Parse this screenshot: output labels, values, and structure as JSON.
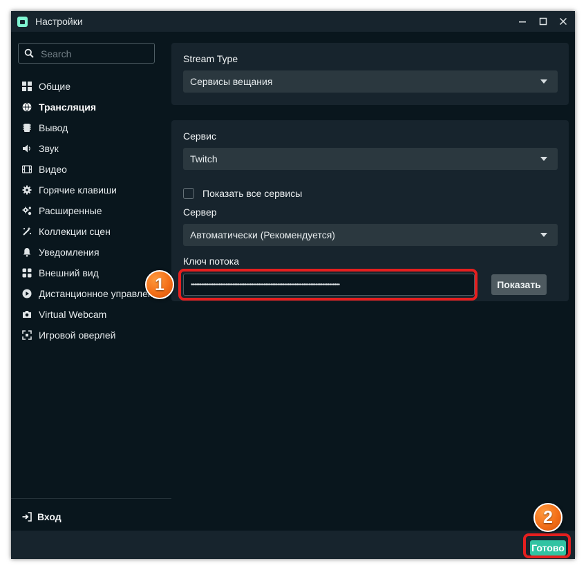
{
  "window": {
    "title": "Настройки"
  },
  "sidebar": {
    "search_placeholder": "Search",
    "items": [
      {
        "label": "Общие",
        "icon": "grid-icon",
        "active": false
      },
      {
        "label": "Трансляция",
        "icon": "globe-icon",
        "active": true
      },
      {
        "label": "Вывод",
        "icon": "chip-icon",
        "active": false
      },
      {
        "label": "Звук",
        "icon": "speaker-icon",
        "active": false
      },
      {
        "label": "Видео",
        "icon": "film-icon",
        "active": false
      },
      {
        "label": "Горячие клавиши",
        "icon": "gear-icon",
        "active": false
      },
      {
        "label": "Расширенные",
        "icon": "gears-icon",
        "active": false
      },
      {
        "label": "Коллекции сцен",
        "icon": "magic-wand-icon",
        "active": false
      },
      {
        "label": "Уведомления",
        "icon": "bell-icon",
        "active": false
      },
      {
        "label": "Внешний вид",
        "icon": "palette-icon",
        "active": false
      },
      {
        "label": "Дистанционное управление",
        "icon": "play-circle-icon",
        "active": false
      },
      {
        "label": "Virtual Webcam",
        "icon": "camera-icon",
        "active": false
      },
      {
        "label": "Игровой оверлей",
        "icon": "overlay-icon",
        "active": false
      }
    ],
    "logout_label": "Вход"
  },
  "stream_type": {
    "label": "Stream Type",
    "value": "Сервисы вещания"
  },
  "service": {
    "label": "Сервис",
    "value": "Twitch",
    "show_all_label": "Показать все сервисы",
    "show_all_checked": false
  },
  "server": {
    "label": "Сервер",
    "value": "Автоматически (Рекомендуется)"
  },
  "stream_key": {
    "label": "Ключ потока",
    "masked_value": "••••••••••••••••••••••••••••••••••••••••••••••••••••••••••••••••••••••••••••••••••••••",
    "show_button": "Показать"
  },
  "footer": {
    "done_label": "Готово"
  },
  "annotations": {
    "step1": "1",
    "step2": "2"
  },
  "colors": {
    "accent": "#31c3a2",
    "background": "#09161d",
    "panel": "#17242d",
    "highlight": "#e51f1f",
    "badge": "#f36f18"
  }
}
